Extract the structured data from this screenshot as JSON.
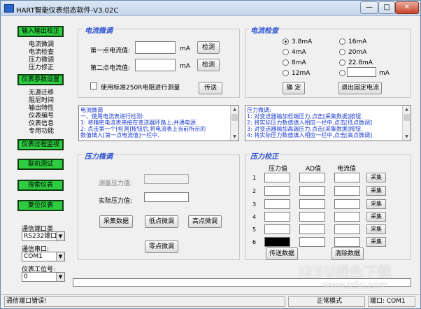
{
  "window": {
    "title": "HART智能仪表组态软件-V3.02C",
    "min": "—",
    "max": "□",
    "close": "✕"
  },
  "side": {
    "btn_io_calibration": "输入输出校正",
    "io_links": [
      "电流微调",
      "电流检查",
      "压力微调",
      "压力修正"
    ],
    "btn_param_settings": "仪表参数设置",
    "param_links": [
      "无源迁移",
      "阻尼时间",
      "输出特性",
      "仪表编号",
      "仪表信息",
      "专用功能"
    ],
    "btn_process_monitor": "仪表过程监视",
    "btn_online_test": "联机测试",
    "btn_search": "搜索仪表",
    "btn_reset": "复位仪表",
    "port_type_label": "通信端口类型:",
    "port_type_value": "RS232端口",
    "serial_label": "通信串口:",
    "serial_value": "COM1",
    "station_label": "仪表工位号:",
    "station_value": "0"
  },
  "current_trim": {
    "title": "电流微调",
    "point1_label": "第一点电流值:",
    "point1_unit": "mA",
    "point1_btn": "检测",
    "point2_label": "第二点电流值:",
    "point2_unit": "mA",
    "point2_btn": "检测",
    "resistor_check": "使用标准250R电阻进行测量",
    "send_btn": "传送",
    "help": [
      "电流微调",
      "一、使用电流表进行检测:",
      "  1: 将精密电流表串接在变送器环路上,并通电源.",
      "  2: 点击第一个[检测]按钮后,将电流表上当前所示的",
      "     数值填入[第一点电流值]一栏中."
    ]
  },
  "current_check": {
    "title": "电流检查",
    "options": [
      "3.8mA",
      "16mA",
      "4mA",
      "20mA",
      "8mA",
      "22.8mA",
      "12mA"
    ],
    "custom_unit": "mA",
    "confirm_btn": "确 定",
    "exit_btn": "退出固定电流",
    "help": [
      "压力微调:",
      "1: 对变送器输加低端压力,点击[采集数据]按钮.",
      "2: 将实际压力数值填入相应一栏中,点击[低点微调]",
      "3: 对变送器输加高端压力,点击[采集数据]按钮.",
      "4: 将实际压力数值填入相应一栏中,点击[高点微调]"
    ]
  },
  "pressure_trim": {
    "title": "压力微调",
    "measured_label": "测量压力值:",
    "actual_label": "实际压力值:",
    "collect_btn": "采集数据",
    "low_btn": "低点微调",
    "high_btn": "高点微调",
    "zero_btn": "零点微调"
  },
  "pressure_correct": {
    "title": "压力校正",
    "col_pressure": "压力值",
    "col_ad": "AD值",
    "col_current": "电流值",
    "rows": [
      "1",
      "2",
      "3",
      "4",
      "5",
      "6"
    ],
    "collect_btn": "采集",
    "send_btn": "传送数据",
    "clear_btn": "清除数据"
  },
  "status": {
    "message": "通信端口错误!",
    "mode": "正常模式",
    "port": "端口: COM1"
  },
  "watermark": {
    "text": "IZSU绿色下载",
    "url": "www.iz5u.com"
  }
}
